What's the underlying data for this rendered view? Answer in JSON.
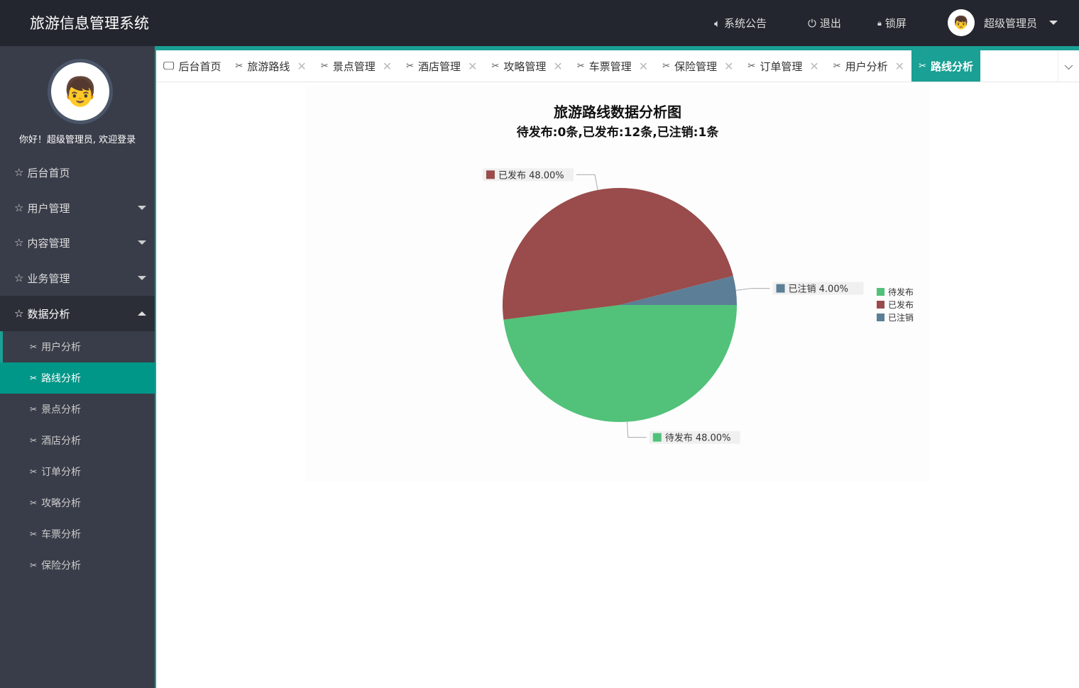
{
  "header": {
    "title": "旅游信息管理系统",
    "notice": "系统公告",
    "logout": "退出",
    "lock": "锁屏",
    "user": "超级管理员"
  },
  "sidebar": {
    "welcome": "你好！超级管理员, 欢迎登录",
    "menu": [
      {
        "label": "后台首页"
      },
      {
        "label": "用户管理"
      },
      {
        "label": "内容管理"
      },
      {
        "label": "业务管理"
      },
      {
        "label": "数据分析"
      }
    ],
    "submenu": [
      {
        "label": "用户分析"
      },
      {
        "label": "路线分析"
      },
      {
        "label": "景点分析"
      },
      {
        "label": "酒店分析"
      },
      {
        "label": "订单分析"
      },
      {
        "label": "攻略分析"
      },
      {
        "label": "车票分析"
      },
      {
        "label": "保险分析"
      }
    ]
  },
  "tabs": [
    {
      "label": "后台首页"
    },
    {
      "label": "旅游路线"
    },
    {
      "label": "景点管理"
    },
    {
      "label": "酒店管理"
    },
    {
      "label": "攻略管理"
    },
    {
      "label": "车票管理"
    },
    {
      "label": "保险管理"
    },
    {
      "label": "订单管理"
    },
    {
      "label": "用户分析"
    },
    {
      "label": "路线分析"
    }
  ],
  "chart_data": {
    "type": "pie",
    "title": "旅游路线数据分析图",
    "subtitle": "待发布:0条,已发布:12条,已注销:1条",
    "legend_position": "right",
    "slices": [
      {
        "name": "待发布",
        "percent": 48.0,
        "label": "待发布 48.00%",
        "color": "#52c17a"
      },
      {
        "name": "已发布",
        "percent": 48.0,
        "label": "已发布 48.00%",
        "color": "#9a4b4b"
      },
      {
        "name": "已注销",
        "percent": 4.0,
        "label": "已注销 4.00%",
        "color": "#5c7e96"
      }
    ]
  }
}
